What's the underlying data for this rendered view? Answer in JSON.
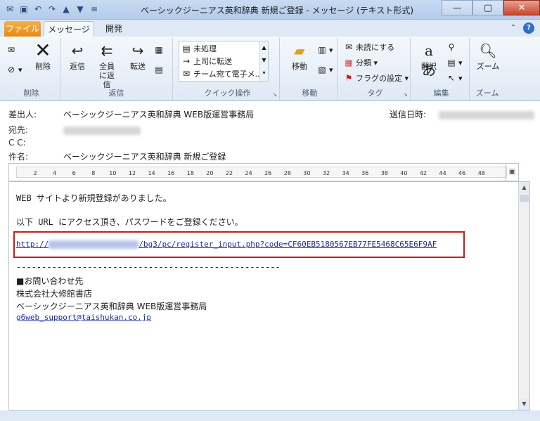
{
  "window": {
    "title": "ベーシックジーニアス英和辞典 新規ご登録 - メッセージ (テキスト形式)",
    "qat_icons": [
      "mail-icon",
      "save-icon",
      "undo-icon",
      "redo-icon",
      "up-arrow-icon",
      "down-arrow-icon",
      "customize-icon"
    ],
    "controls": {
      "minimize": "—",
      "maximize": "▢",
      "close": "✕"
    }
  },
  "tabs": {
    "file": "ファイル",
    "message": "メッセージ",
    "develop": "開発"
  },
  "ribbon": {
    "delete_group": {
      "label": "削除",
      "delete": "削除"
    },
    "respond_group": {
      "label": "返信",
      "reply": "返信",
      "reply_all": "全員に返信",
      "forward": "転送"
    },
    "quicksteps_group": {
      "label": "クイック操作",
      "items": [
        "未処理",
        "上司に転送",
        "チーム宛て電子メ..."
      ]
    },
    "move_group": {
      "label": "移動",
      "move": "移動"
    },
    "tags_group": {
      "label": "タグ",
      "mark_unread": "未読にする",
      "categorize": "分類",
      "follow_up": "フラグの設定"
    },
    "editing_group": {
      "label": "編集",
      "translate": "翻訳"
    },
    "zoom_group": {
      "label": "ズーム",
      "zoom": "ズーム"
    }
  },
  "header": {
    "from_label": "差出人:",
    "from_value": "ベーシックジーニアス英和辞典 WEB版運営事務局",
    "to_label": "宛先:",
    "cc_label": "C C:",
    "subject_label": "件名:",
    "subject_value": "ベーシックジーニアス英和辞典 新規ご登録",
    "sent_label": "送信日時:"
  },
  "ruler": {
    "ticks": [
      "2",
      "4",
      "6",
      "8",
      "10",
      "12",
      "14",
      "16",
      "18",
      "20",
      "22",
      "24",
      "26",
      "28",
      "30",
      "32",
      "34",
      "36",
      "38",
      "40",
      "42",
      "44",
      "46",
      "48"
    ]
  },
  "body": {
    "line1": "WEB サイトより新規登録がありました。",
    "line2": "以下 URL にアクセス頂き、パスワードをご登録ください。",
    "url_prefix": "http://",
    "url_suffix": "/bg3/pc/register_input.php?code=CF60EB5180567EB77FE5468C65E6F9AF",
    "divider": "----------------------------------------------------",
    "contact_title": "■お問い合わせ先",
    "company": "株式会社大修館書店",
    "office": "ベーシックジーニアス英和辞典 WEB版運営事務局",
    "email": "g6web_support@taishukan.co.jp"
  }
}
